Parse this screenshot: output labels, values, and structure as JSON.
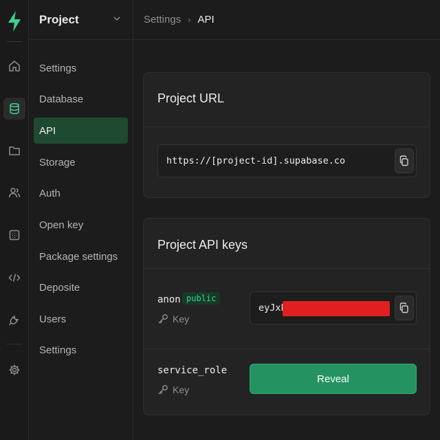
{
  "header": {
    "project_name": "Project",
    "breadcrumb": [
      "Settings",
      "API"
    ]
  },
  "rail": {
    "icons": [
      "logo-icon",
      "home-icon",
      "database-icon",
      "folder-icon",
      "users-icon",
      "calendar-icon",
      "code-icon",
      "plug-icon",
      "gear-icon"
    ],
    "active": "database-icon",
    "accent": "#3ecf8e"
  },
  "sidebar": {
    "items": [
      {
        "label": "Settings"
      },
      {
        "label": "Database"
      },
      {
        "label": "API",
        "active": true
      },
      {
        "label": "Storage"
      },
      {
        "label": "Auth"
      },
      {
        "label": "Open key"
      },
      {
        "label": "Package settings"
      },
      {
        "label": "Deposite"
      },
      {
        "label": "Users"
      },
      {
        "label": "Settings"
      }
    ]
  },
  "project_url": {
    "title": "Project URL",
    "value": "https://[project-id].supabase.co"
  },
  "api_keys": {
    "title": "Project API keys",
    "anon": {
      "label": "anon",
      "badge": "public",
      "sub": "Key",
      "value_prefix": "eyJxh"
    },
    "service_role": {
      "label": "service_role",
      "sub": "Key",
      "button": "Reveal"
    }
  },
  "colors": {
    "background": "#1c1c1c",
    "card": "#232323",
    "accent_green": "#3ecf8e",
    "button_green": "#249361",
    "redaction_red": "#e02020"
  }
}
